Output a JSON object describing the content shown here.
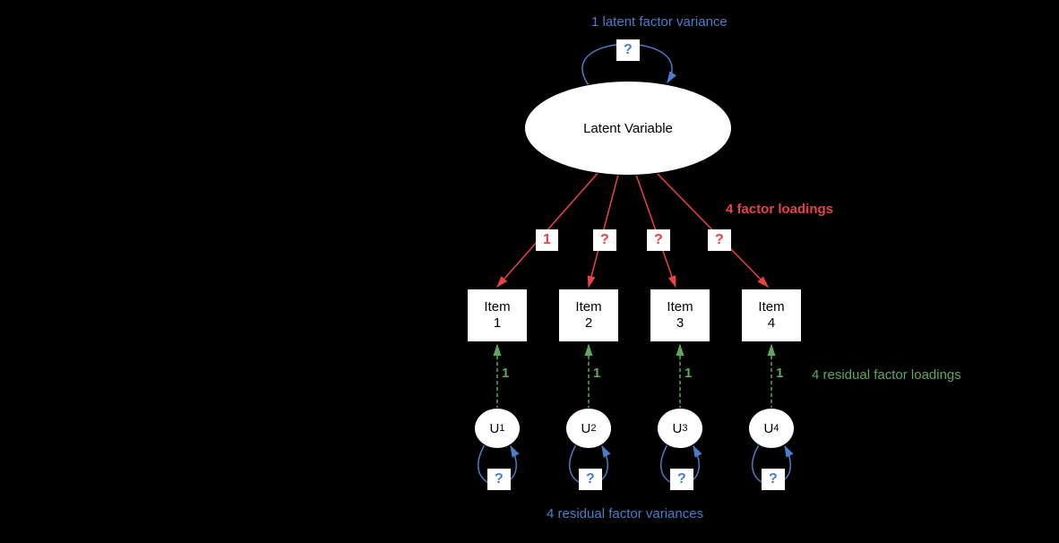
{
  "title_top": "1 latent factor variance",
  "latent_label": "Latent Variable",
  "factor_loadings_label": "4 factor loadings",
  "loading_values": [
    "1",
    "?",
    "?",
    "?"
  ],
  "items": [
    "Item 1",
    "Item 2",
    "Item 3",
    "Item 4"
  ],
  "residual_loading_value": "1",
  "residual_loadings_label": "4 residual factor loadings",
  "residuals": [
    "U₁",
    "U₂",
    "U₃",
    "U₄"
  ],
  "residual_variance_q": "?",
  "residual_variances_label": "4 residual factor variances",
  "latent_variance_q": "?"
}
